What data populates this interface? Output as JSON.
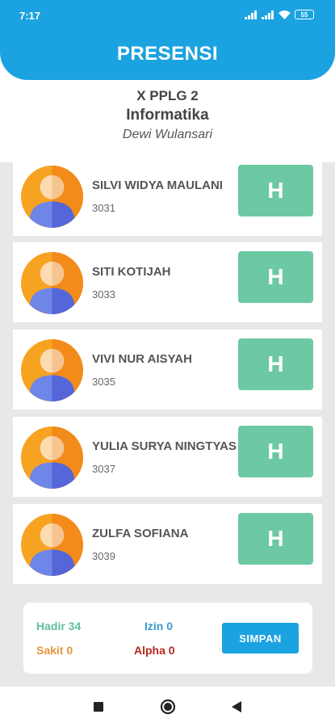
{
  "status_bar": {
    "time": "7:17",
    "battery": "55"
  },
  "header": {
    "title": "PRESENSI"
  },
  "class_info": {
    "class_name": "X PPLG 2",
    "subject": "Informatika",
    "teacher": "Dewi Wulansari"
  },
  "students": [
    {
      "name": "SILVI WIDYA MAULANI",
      "id": "3031",
      "status": "H"
    },
    {
      "name": "SITI KOTIJAH",
      "id": "3033",
      "status": "H"
    },
    {
      "name": "VIVI NUR AISYAH",
      "id": "3035",
      "status": "H"
    },
    {
      "name": "YULIA SURYA NINGTYAS",
      "id": "3037",
      "status": "H"
    },
    {
      "name": "ZULFA SOFIANA",
      "id": "3039",
      "status": "H"
    }
  ],
  "summary": {
    "hadir": "Hadir 34",
    "izin": "Izin 0",
    "sakit": "Sakit 0",
    "alpha": "Alpha 0",
    "save_label": "SIMPAN"
  },
  "colors": {
    "primary": "#1ba2e0",
    "present": "#6cc9a3",
    "hadir": "#5fc09b",
    "izin": "#3a9bd0",
    "sakit": "#e5963a",
    "alpha": "#b5271d"
  },
  "nav": {
    "icons": [
      "recents-square-icon",
      "home-circle-icon",
      "back-triangle-icon"
    ]
  }
}
